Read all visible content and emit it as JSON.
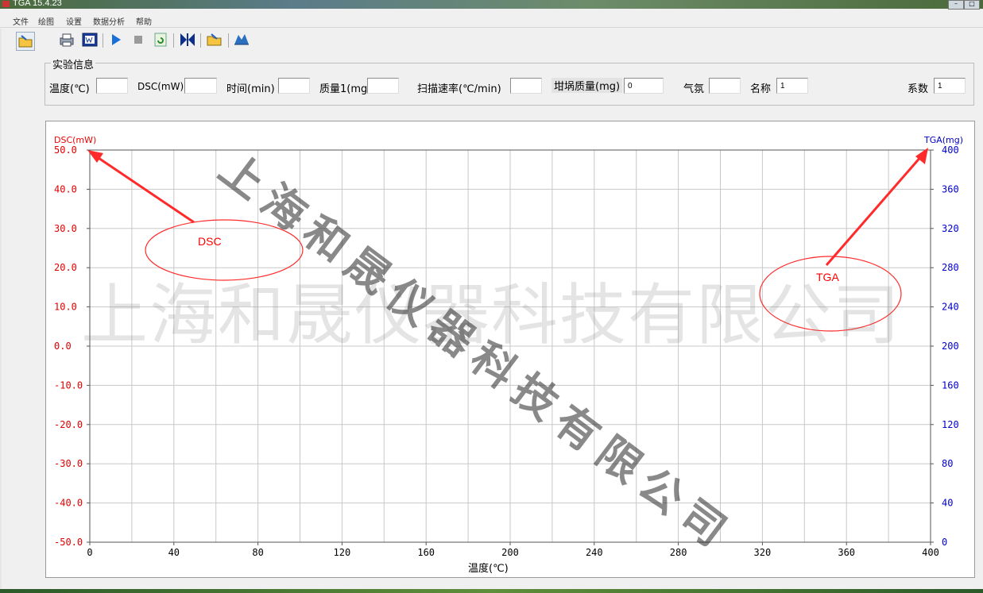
{
  "window": {
    "title": "TGA 15.4.23"
  },
  "menu": [
    "文件",
    "绘图",
    "设置",
    "数据分析",
    "帮助"
  ],
  "toolbar": {
    "icons": [
      "open-folder-icon",
      "print-icon",
      "export-icon",
      "play-icon",
      "stop-icon",
      "refresh-icon",
      "marker-icon",
      "open-icon",
      "help-icon"
    ]
  },
  "experiment": {
    "title": "实验信息",
    "temperature_label": "温度(℃)",
    "temperature_value": "",
    "dsc_label": "DSC(mW)",
    "dsc_value": "",
    "time_label": "时间(min)",
    "time_value": "",
    "mass1_label": "质量1(mg",
    "mass1_value": "",
    "scan_rate_label": "扫描速率(℃/min)",
    "scan_rate_value": "",
    "crucible_mass_label": "坩埚质量(mg)",
    "crucible_mass_value": "0",
    "atmosphere_label": "气氛",
    "atmosphere_value": "",
    "name_label": "名称",
    "name_value": "1",
    "coef_label": "系数",
    "coef_value": "1"
  },
  "chart_data": {
    "type": "line",
    "xlabel": "温度(℃)",
    "ylabel_left": "DSC(mW)",
    "ylabel_right": "TGA(mg)",
    "xlim": [
      0,
      400
    ],
    "ylim_left": [
      -50,
      50
    ],
    "ylim_right": [
      0,
      400
    ],
    "x_ticks": [
      "0",
      "40",
      "80",
      "120",
      "160",
      "200",
      "240",
      "280",
      "320",
      "360",
      "400"
    ],
    "y_left_ticks": [
      "50.0",
      "40.0",
      "30.0",
      "20.0",
      "10.0",
      "0.0",
      "-10.0",
      "-20.0",
      "-30.0",
      "-40.0",
      "-50.0"
    ],
    "y_right_ticks": [
      "400",
      "360",
      "320",
      "280",
      "240",
      "200",
      "160",
      "120",
      "80",
      "40",
      "0"
    ],
    "grid": true,
    "series": [],
    "colors": {
      "left": "#e00000",
      "right": "#0000d0",
      "grid": "#c8c8c8"
    }
  },
  "annotations": {
    "dsc": "DSC",
    "tga": "TGA",
    "arrow_color": "#ff2a2a"
  },
  "watermark": {
    "text": "上海和晟仪器科技有限公司"
  }
}
